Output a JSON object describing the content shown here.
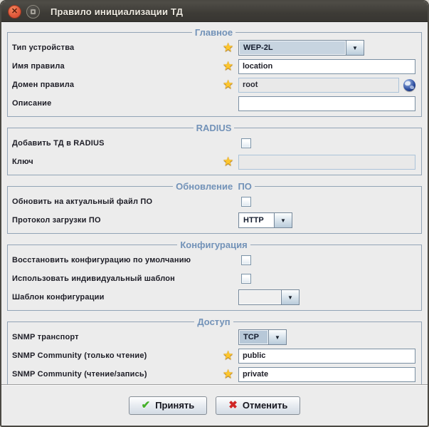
{
  "window": {
    "title": "Правило инициализации ТД"
  },
  "icons": {
    "close": "✕",
    "combo_arrow": "▼",
    "star": "★",
    "accept": "✔",
    "cancel": "✖"
  },
  "colors": {
    "titlebar": "#3d3b36",
    "legend": "#7292b8",
    "fieldset_border": "#92a4b6",
    "star": "#fdc62d",
    "close_button": "#e25a3c",
    "accept_check": "#45b02a",
    "cancel_cross": "#cf2727",
    "selected_combo": "#c7d4e0"
  },
  "groups": [
    {
      "legend": "Главное",
      "rows": [
        {
          "label": "Тип устройства",
          "required": true,
          "control": "combo",
          "value": "WEP-2L"
        },
        {
          "label": "Имя правила",
          "required": true,
          "control": "text",
          "value": "location"
        },
        {
          "label": "Домен правила",
          "required": true,
          "control": "text-disabled-globe",
          "value": "root"
        },
        {
          "label": "Описание",
          "required": false,
          "control": "text",
          "value": ""
        }
      ]
    },
    {
      "legend": "RADIUS",
      "rows": [
        {
          "label": "Добавить ТД в RADIUS",
          "control": "checkbox",
          "checked": false
        },
        {
          "label": "Ключ",
          "required": true,
          "control": "text-disabled",
          "value": ""
        }
      ]
    },
    {
      "legend": "Обновление  ПО",
      "rows": [
        {
          "label": "Обновить на актуальный файл ПО",
          "control": "checkbox",
          "checked": false
        },
        {
          "label": "Протокол загрузки ПО",
          "control": "combo",
          "value": "HTTP"
        }
      ]
    },
    {
      "legend": "Конфигурация",
      "rows": [
        {
          "label": "Восстановить конфигурацию по умолчанию",
          "control": "checkbox",
          "checked": false
        },
        {
          "label": "Использовать индивидуальный шаблон",
          "control": "checkbox",
          "checked": false
        },
        {
          "label": "Шаблон конфигурации",
          "control": "combo",
          "value": ""
        }
      ]
    },
    {
      "legend": "Доступ",
      "rows": [
        {
          "label": "SNMP транспорт",
          "control": "combo",
          "value": "TCP"
        },
        {
          "label": "SNMP Community (только чтение)",
          "required": true,
          "control": "text",
          "value": "public"
        },
        {
          "label": "SNMP Community (чтение/запись)",
          "required": true,
          "control": "text",
          "value": "private"
        }
      ]
    }
  ],
  "footer": {
    "accept": "Принять",
    "cancel": "Отменить"
  }
}
